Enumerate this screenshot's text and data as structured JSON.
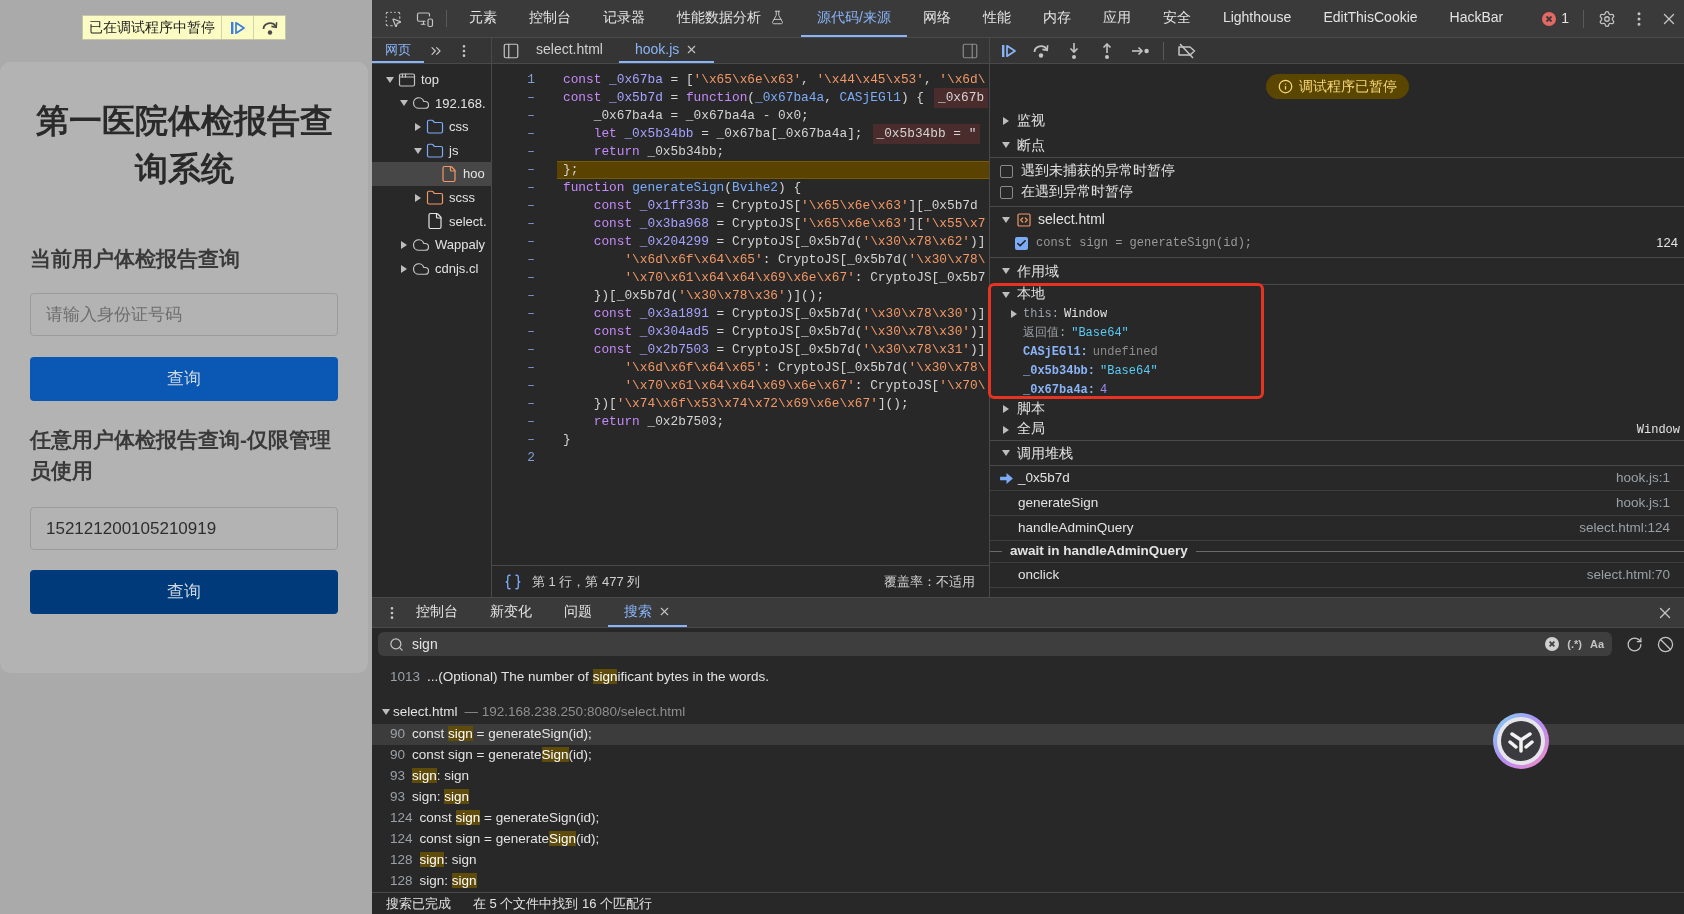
{
  "page": {
    "paused_banner": "已在调试程序中暂停",
    "title": "第一医院体检报告查询系统",
    "sections": [
      {
        "heading": "当前用户体检报告查询",
        "field": {
          "placeholder": "请输入身份证号码"
        },
        "button": {
          "label": "查询",
          "pressed": false
        }
      },
      {
        "heading": "任意用户体检报告查询-仅限管理员使用",
        "field": {
          "value": "152121200105210919"
        },
        "button": {
          "label": "查询",
          "pressed": true
        }
      }
    ]
  },
  "devtools": {
    "tabs": [
      {
        "label": "元素",
        "selected": false
      },
      {
        "label": "控制台",
        "selected": false
      },
      {
        "label": "记录器",
        "selected": false
      },
      {
        "label": "性能数据分析",
        "selected": false,
        "experimental": true
      },
      {
        "label": "源代码/来源",
        "selected": true
      },
      {
        "label": "网络",
        "selected": false
      },
      {
        "label": "性能",
        "selected": false
      },
      {
        "label": "内存",
        "selected": false
      },
      {
        "label": "应用",
        "selected": false
      },
      {
        "label": "安全",
        "selected": false
      },
      {
        "label": "Lighthouse",
        "selected": false
      },
      {
        "label": "EditThisCookie",
        "selected": false
      },
      {
        "label": "HackBar",
        "selected": false
      }
    ],
    "error_count": "1"
  },
  "navigator": {
    "tabs": [
      {
        "label": "网页",
        "selected": true
      }
    ],
    "tree": [
      {
        "label": "top",
        "kind": "frame",
        "expanded": true,
        "selected": false,
        "children": [
          {
            "label": "192.168.",
            "kind": "cloud",
            "expanded": true,
            "selected": false,
            "children": [
              {
                "label": "css",
                "kind": "folder",
                "color": "#7cacf8",
                "expanded": false,
                "selected": false
              },
              {
                "label": "js",
                "kind": "folder",
                "color": "#7cacf8",
                "expanded": true,
                "selected": false,
                "children": [
                  {
                    "label": "hoo",
                    "kind": "file",
                    "color": "#f29766",
                    "selected": true
                  }
                ]
              },
              {
                "label": "scss",
                "kind": "folder",
                "color": "#f29766",
                "expanded": false,
                "selected": false
              },
              {
                "label": "select.",
                "kind": "file",
                "color": "#e3e3e3",
                "selected": false
              }
            ]
          },
          {
            "label": "Wappaly",
            "kind": "cloud",
            "expanded": false,
            "selected": false
          },
          {
            "label": "cdnjs.cl",
            "kind": "cloud",
            "expanded": false,
            "selected": false
          }
        ]
      }
    ]
  },
  "editor": {
    "tabs": [
      {
        "label": "select.html",
        "selected": false
      },
      {
        "label": "hook.js",
        "selected": true,
        "closable": true
      }
    ],
    "lines": [
      {
        "number": "1",
        "paused": false,
        "tokens": [
          {
            "kind": "kw",
            "text": "const "
          },
          {
            "kind": "def",
            "text": "_0x67ba"
          },
          {
            "kind": "plain",
            "text": " = ["
          },
          {
            "kind": "str",
            "text": "'\\x65\\x6e\\x63'"
          },
          {
            "kind": "plain",
            "text": ", "
          },
          {
            "kind": "str",
            "text": "'\\x44\\x45\\x53'"
          },
          {
            "kind": "plain",
            "text": ", "
          },
          {
            "kind": "str",
            "text": "'\\x6d\\"
          }
        ]
      },
      {
        "number": "–",
        "paused": false,
        "tokens": [
          {
            "kind": "kw",
            "text": "const "
          },
          {
            "kind": "def",
            "text": "_0x5b7d"
          },
          {
            "kind": "plain",
            "text": " = "
          },
          {
            "kind": "kw",
            "text": "function"
          },
          {
            "kind": "plain",
            "text": "("
          },
          {
            "kind": "param",
            "text": "_0x67ba4a"
          },
          {
            "kind": "plain",
            "text": ", "
          },
          {
            "kind": "param",
            "text": "CASjEGl1"
          },
          {
            "kind": "plain",
            "text": ") {"
          }
        ],
        "inline_value": "_0x67b"
      },
      {
        "number": "–",
        "paused": false,
        "tokens": [
          {
            "kind": "plain",
            "text": "    _0x67ba4a = _0x67ba4a - 0x0;"
          }
        ]
      },
      {
        "number": "–",
        "paused": false,
        "tokens": [
          {
            "kind": "kw",
            "text": "    let "
          },
          {
            "kind": "def",
            "text": "_0x5b34bb"
          },
          {
            "kind": "plain",
            "text": " = _0x67ba[_0x67ba4a];"
          }
        ],
        "inline_value": "_0x5b34bb = \""
      },
      {
        "number": "–",
        "paused": false,
        "tokens": [
          {
            "kind": "kw",
            "text": "    return "
          },
          {
            "kind": "plain",
            "text": "_0x5b34bb;"
          }
        ]
      },
      {
        "number": "–",
        "paused": true,
        "tokens": [
          {
            "kind": "plain",
            "text": "};"
          }
        ]
      },
      {
        "number": "–",
        "paused": false,
        "tokens": [
          {
            "kind": "kw",
            "text": "function "
          },
          {
            "kind": "param",
            "text": "generateSign"
          },
          {
            "kind": "plain",
            "text": "("
          },
          {
            "kind": "param",
            "text": "Bvihe2"
          },
          {
            "kind": "plain",
            "text": ") {"
          }
        ]
      },
      {
        "number": "–",
        "paused": false,
        "tokens": [
          {
            "kind": "kw",
            "text": "    const "
          },
          {
            "kind": "def",
            "text": "_0x1ff33b"
          },
          {
            "kind": "plain",
            "text": " = CryptoJS["
          },
          {
            "kind": "str",
            "text": "'\\x65\\x6e\\x63'"
          },
          {
            "kind": "plain",
            "text": "][_0x5b7d"
          }
        ]
      },
      {
        "number": "–",
        "paused": false,
        "tokens": [
          {
            "kind": "kw",
            "text": "    const "
          },
          {
            "kind": "def",
            "text": "_0x3ba968"
          },
          {
            "kind": "plain",
            "text": " = CryptoJS["
          },
          {
            "kind": "str",
            "text": "'\\x65\\x6e\\x63'"
          },
          {
            "kind": "plain",
            "text": "]["
          },
          {
            "kind": "str",
            "text": "'\\x55\\x7"
          }
        ]
      },
      {
        "number": "–",
        "paused": false,
        "tokens": [
          {
            "kind": "kw",
            "text": "    const "
          },
          {
            "kind": "def",
            "text": "_0x204299"
          },
          {
            "kind": "plain",
            "text": " = CryptoJS[_0x5b7d("
          },
          {
            "kind": "str",
            "text": "'\\x30\\x78\\x62'"
          },
          {
            "kind": "plain",
            "text": ")]"
          }
        ]
      },
      {
        "number": "–",
        "paused": false,
        "tokens": [
          {
            "kind": "str",
            "text": "        '\\x6d\\x6f\\x64\\x65'"
          },
          {
            "kind": "plain",
            "text": ": CryptoJS[_0x5b7d("
          },
          {
            "kind": "str",
            "text": "'\\x30\\x78\\"
          }
        ]
      },
      {
        "number": "–",
        "paused": false,
        "tokens": [
          {
            "kind": "str",
            "text": "        '\\x70\\x61\\x64\\x64\\x69\\x6e\\x67'"
          },
          {
            "kind": "plain",
            "text": ": CryptoJS[_0x5b7"
          }
        ]
      },
      {
        "number": "–",
        "paused": false,
        "tokens": [
          {
            "kind": "plain",
            "text": "    })[_0x5b7d("
          },
          {
            "kind": "str",
            "text": "'\\x30\\x78\\x36'"
          },
          {
            "kind": "plain",
            "text": ")]();"
          }
        ]
      },
      {
        "number": "–",
        "paused": false,
        "tokens": [
          {
            "kind": "kw",
            "text": "    const "
          },
          {
            "kind": "def",
            "text": "_0x3a1891"
          },
          {
            "kind": "plain",
            "text": " = CryptoJS[_0x5b7d("
          },
          {
            "kind": "str",
            "text": "'\\x30\\x78\\x30'"
          },
          {
            "kind": "plain",
            "text": ")]"
          }
        ]
      },
      {
        "number": "–",
        "paused": false,
        "tokens": [
          {
            "kind": "kw",
            "text": "    const "
          },
          {
            "kind": "def",
            "text": "_0x304ad5"
          },
          {
            "kind": "plain",
            "text": " = CryptoJS[_0x5b7d("
          },
          {
            "kind": "str",
            "text": "'\\x30\\x78\\x30'"
          },
          {
            "kind": "plain",
            "text": ")]"
          }
        ]
      },
      {
        "number": "–",
        "paused": false,
        "tokens": [
          {
            "kind": "kw",
            "text": "    const "
          },
          {
            "kind": "def",
            "text": "_0x2b7503"
          },
          {
            "kind": "plain",
            "text": " = CryptoJS[_0x5b7d("
          },
          {
            "kind": "str",
            "text": "'\\x30\\x78\\x31'"
          },
          {
            "kind": "plain",
            "text": ")]"
          }
        ]
      },
      {
        "number": "–",
        "paused": false,
        "tokens": [
          {
            "kind": "str",
            "text": "        '\\x6d\\x6f\\x64\\x65'"
          },
          {
            "kind": "plain",
            "text": ": CryptoJS[_0x5b7d("
          },
          {
            "kind": "str",
            "text": "'\\x30\\x78\\"
          }
        ]
      },
      {
        "number": "–",
        "paused": false,
        "tokens": [
          {
            "kind": "str",
            "text": "        '\\x70\\x61\\x64\\x64\\x69\\x6e\\x67'"
          },
          {
            "kind": "plain",
            "text": ": CryptoJS["
          },
          {
            "kind": "str",
            "text": "'\\x70\\"
          }
        ]
      },
      {
        "number": "–",
        "paused": false,
        "tokens": [
          {
            "kind": "plain",
            "text": "    })["
          },
          {
            "kind": "str",
            "text": "'\\x74\\x6f\\x53\\x74\\x72\\x69\\x6e\\x67'"
          },
          {
            "kind": "plain",
            "text": "]();"
          }
        ]
      },
      {
        "number": "–",
        "paused": false,
        "tokens": [
          {
            "kind": "kw",
            "text": "    return "
          },
          {
            "kind": "plain",
            "text": "_0x2b7503;"
          }
        ]
      },
      {
        "number": "–",
        "paused": false,
        "tokens": [
          {
            "kind": "plain",
            "text": "}"
          }
        ]
      },
      {
        "number": "2",
        "paused": false
      }
    ],
    "status": {
      "position": "第 1 行，第 477 列",
      "coverage": "覆盖率：不适用"
    }
  },
  "debugger": {
    "paused_badge": "调试程序已暂停",
    "watch": {
      "title": "监视",
      "expanded": false
    },
    "breakpoints": {
      "title": "断点",
      "expanded": true,
      "options": [
        {
          "label": "遇到未捕获的异常时暂停",
          "checked": false
        },
        {
          "label": "在遇到异常时暂停",
          "checked": false
        }
      ],
      "files": [
        {
          "name": "select.html",
          "expanded": true,
          "items": [
            {
              "code": "const sign = generateSign(id);",
              "line": "124",
              "checked": true
            }
          ]
        }
      ]
    },
    "scope": {
      "title": "作用域",
      "expanded": true,
      "groups": [
        {
          "title": "本地",
          "expanded": true,
          "variables": [
            {
              "name": "this:",
              "kind": "special",
              "value": {
                "kind": "object",
                "text": "Window"
              },
              "expanded": false
            },
            {
              "name": "返回值:",
              "kind": "special",
              "value": {
                "kind": "string",
                "text": "\"Base64\""
              }
            },
            {
              "name": "CASjEGl1:",
              "kind": "local",
              "value": {
                "kind": "undefined",
                "text": "undefined"
              }
            },
            {
              "name": "_0x5b34bb:",
              "kind": "local",
              "value": {
                "kind": "string",
                "text": "\"Base64\""
              }
            },
            {
              "name": "_0x67ba4a:",
              "kind": "local",
              "value": {
                "kind": "number",
                "text": "4"
              }
            }
          ]
        },
        {
          "title": "脚本",
          "expanded": false
        },
        {
          "title": "全局",
          "expanded": false,
          "value": "Window"
        }
      ]
    },
    "call_stack": {
      "title": "调用堆栈",
      "expanded": true,
      "frames": [
        {
          "kind": "frame",
          "name": "_0x5b7d",
          "location": "hook.js:1",
          "selected": true
        },
        {
          "kind": "frame",
          "name": "generateSign",
          "location": "hook.js:1",
          "selected": false
        },
        {
          "kind": "frame",
          "name": "handleAdminQuery",
          "location": "select.html:124",
          "selected": false
        },
        {
          "kind": "async",
          "name": "await in handleAdminQuery"
        },
        {
          "kind": "frame",
          "name": "onclick",
          "location": "select.html:70",
          "selected": false
        }
      ]
    }
  },
  "drawer": {
    "tabs": [
      {
        "label": "控制台",
        "selected": false
      },
      {
        "label": "新变化",
        "selected": false
      },
      {
        "label": "问题",
        "selected": false
      },
      {
        "label": "搜索",
        "selected": true,
        "closable": true
      }
    ],
    "search": {
      "value": "sign",
      "regex_toggle": "(.*)",
      "case_toggle": "Aa"
    },
    "previous_matches": [
      {
        "line": "1013",
        "before": "...(Optional) The number of ",
        "match": "sign",
        "after": "ificant bytes in the words.",
        "selected": false
      }
    ],
    "files": [
      {
        "name": "select.html",
        "path": "— 192.168.238.250:8080/select.html",
        "expanded": true,
        "matches": [
          {
            "line": "90",
            "before": "const ",
            "match": "sign",
            "after": " = generateSign(id);",
            "selected": true
          },
          {
            "line": "90",
            "before": "const sign = generate",
            "match": "Sign",
            "after": "(id);",
            "selected": false
          },
          {
            "line": "93",
            "match": "sign",
            "after": ": sign",
            "selected": false
          },
          {
            "line": "93",
            "before": "sign: ",
            "match": "sign",
            "selected": false
          },
          {
            "line": "124",
            "before": "const ",
            "match": "sign",
            "after": " = generateSign(id);",
            "selected": false
          },
          {
            "line": "124",
            "before": "const sign = generate",
            "match": "Sign",
            "after": "(id);",
            "selected": false
          },
          {
            "line": "128",
            "match": "sign",
            "after": ": sign",
            "selected": false
          },
          {
            "line": "128",
            "before": "sign: ",
            "match": "sign",
            "selected": false
          }
        ]
      }
    ],
    "status": [
      "搜索已完成",
      "在 5 个文件中找到 16 个匹配行"
    ]
  }
}
